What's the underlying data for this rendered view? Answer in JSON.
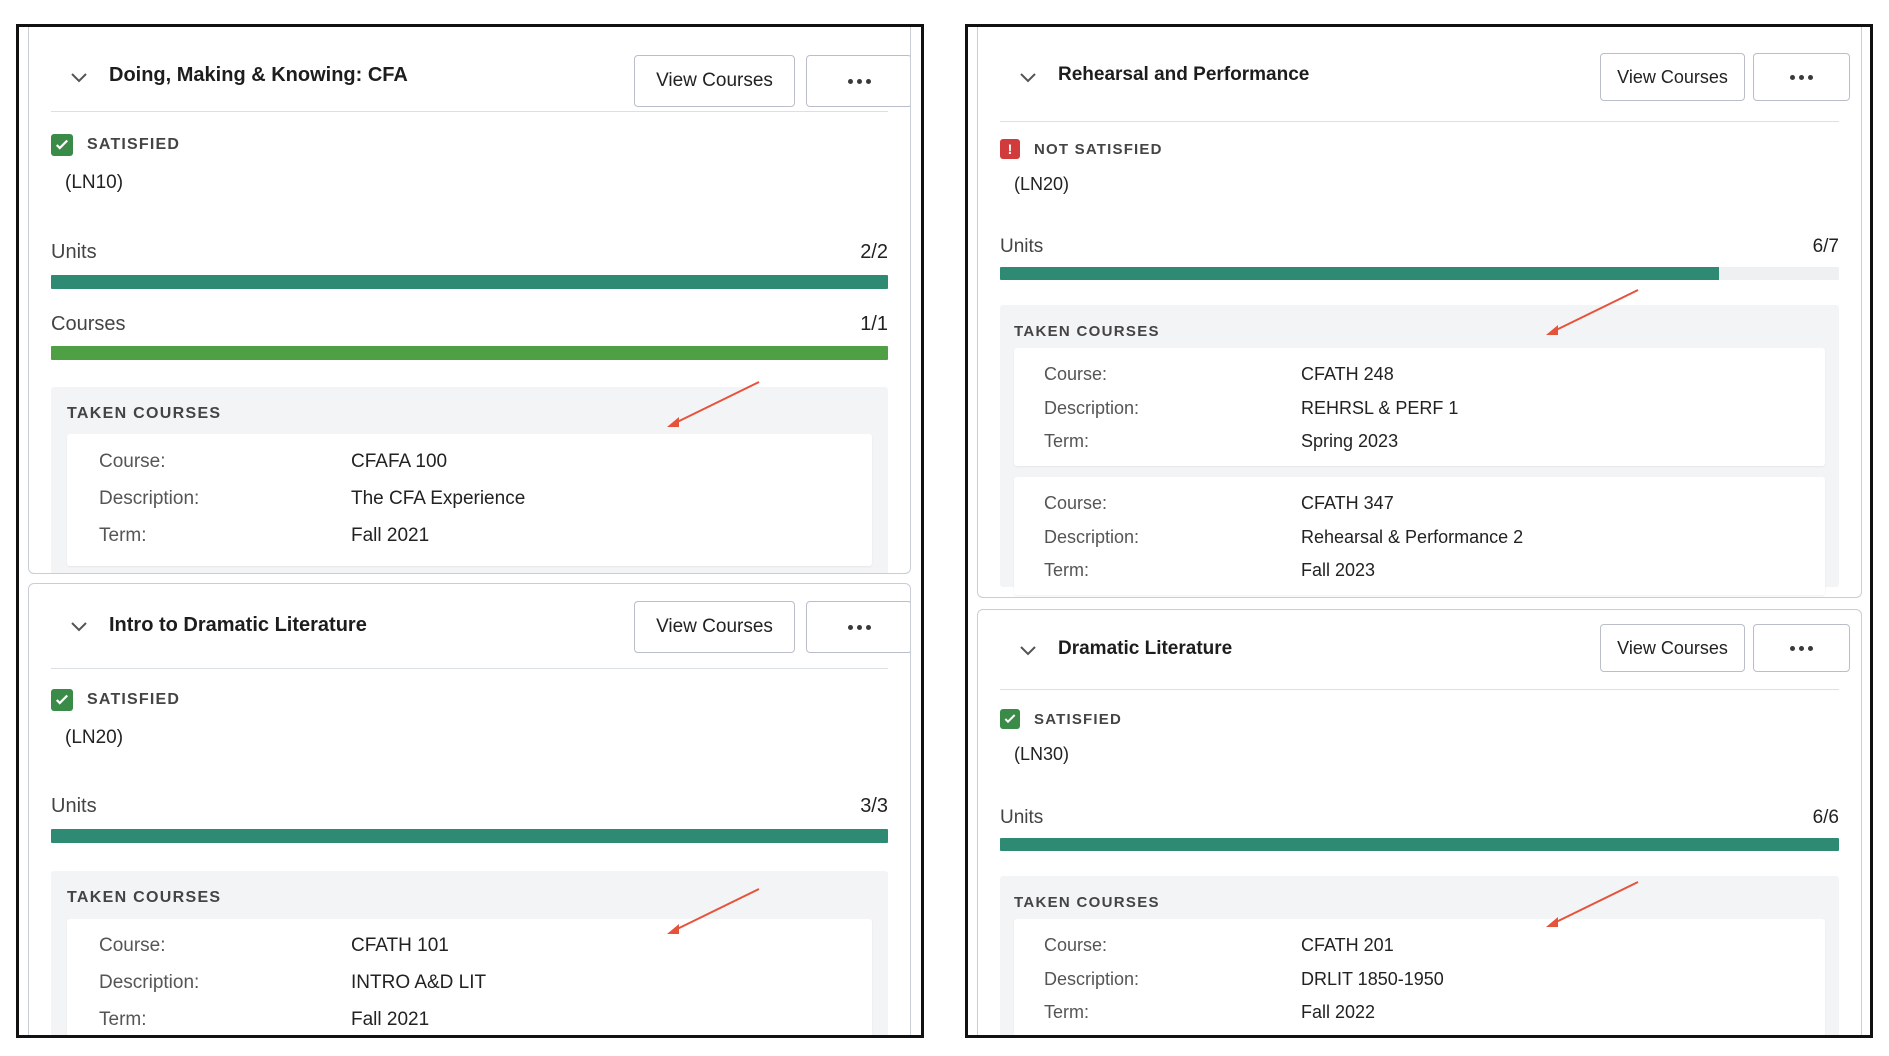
{
  "buttons": {
    "view_courses": "View Courses"
  },
  "labels": {
    "units": "Units",
    "courses": "Courses",
    "taken_courses": "TAKEN COURSES",
    "course": "Course:",
    "description": "Description:",
    "term": "Term:"
  },
  "colors": {
    "satisfied": "#3a8b47",
    "not_satisfied": "#d23b3b",
    "units_bar": "#2f8a74",
    "courses_bar": "#4f9f45"
  },
  "left": {
    "cards": [
      {
        "title": "Doing, Making & Knowing: CFA",
        "status": "SATISFIED",
        "code": "(LN10)",
        "units": {
          "value": "2/2",
          "fraction": 1.0
        },
        "courses": {
          "value": "1/1",
          "fraction": 1.0
        },
        "taken": [
          {
            "course": "CFAFA 100",
            "description": "The CFA Experience",
            "term": "Fall 2021"
          }
        ]
      },
      {
        "title": "Intro to Dramatic Literature",
        "status": "SATISFIED",
        "code": "(LN20)",
        "units": {
          "value": "3/3",
          "fraction": 1.0
        },
        "taken": [
          {
            "course": "CFATH 101",
            "description": "INTRO A&D LIT",
            "term": "Fall 2021"
          }
        ]
      }
    ]
  },
  "right": {
    "cards": [
      {
        "title": "Rehearsal and Performance",
        "status": "NOT SATISFIED",
        "code": "(LN20)",
        "units": {
          "value": "6/7",
          "fraction": 0.857
        },
        "taken": [
          {
            "course": "CFATH 248",
            "description": "REHRSL & PERF 1",
            "term": "Spring 2023"
          },
          {
            "course": "CFATH 347",
            "description": "Rehearsal & Performance 2",
            "term": "Fall 2023"
          }
        ]
      },
      {
        "title": "Dramatic Literature",
        "status": "SATISFIED",
        "code": "(LN30)",
        "units": {
          "value": "6/6",
          "fraction": 1.0
        },
        "taken": [
          {
            "course": "CFATH 201",
            "description": "DRLIT 1850-1950",
            "term": "Fall 2022"
          }
        ]
      }
    ]
  }
}
